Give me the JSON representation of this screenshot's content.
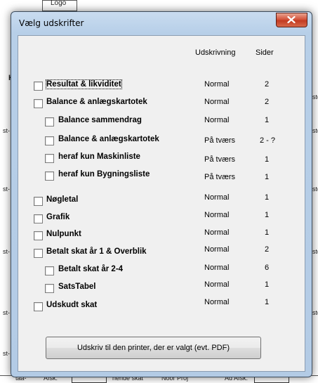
{
  "background": {
    "logo_label": "Logo",
    "left_fragments": [
      "Kl",
      "st-",
      "st-",
      "st-",
      "st-",
      "st-"
    ],
    "right_fragments": [
      "ste",
      "ste",
      "ste",
      "ste",
      "ste"
    ],
    "bottom_fragments": [
      "tåå-",
      "Afsk.",
      "hende skat",
      "Noor Proj",
      "Ad Afsk."
    ]
  },
  "dialog": {
    "title": "Vælg udskrifter",
    "close_icon": "close-icon",
    "columns": {
      "mode": "Udskrivning",
      "pages": "Sider"
    },
    "items": [
      {
        "label": "Resultat & likviditet",
        "mode": "Normal",
        "pages": "2",
        "checked": false
      },
      {
        "label": "Balance & anlægskartotek",
        "mode": "Normal",
        "pages": "2",
        "checked": false
      },
      {
        "label": "Balance sammendrag",
        "mode": "Normal",
        "pages": "1",
        "checked": false
      },
      {
        "label": "Balance & anlægskartotek",
        "mode": "På tværs",
        "pages": "2 - ?",
        "checked": false
      },
      {
        "label": "heraf kun Maskinliste",
        "mode": "På tværs",
        "pages": "1",
        "checked": false
      },
      {
        "label": "heraf kun Bygningsliste",
        "mode": "På tværs",
        "pages": "1",
        "checked": false
      },
      {
        "label": "Nøgletal",
        "mode": "Normal",
        "pages": "1",
        "checked": false
      },
      {
        "label": "Grafik",
        "mode": "Normal",
        "pages": "1",
        "checked": false
      },
      {
        "label": "Nulpunkt",
        "mode": "Normal",
        "pages": "1",
        "checked": false
      },
      {
        "label": "Betalt skat år 1 & Overblik",
        "mode": "Normal",
        "pages": "2",
        "checked": false
      },
      {
        "label": "Betalt skat år 2-4",
        "mode": "Normal",
        "pages": "6",
        "checked": false
      },
      {
        "label": "SatsTabel",
        "mode": "Normal",
        "pages": "1",
        "checked": false
      },
      {
        "label": "Udskudt skat",
        "mode": "Normal",
        "pages": "1",
        "checked": false
      }
    ],
    "print_button": "Udskriv til den printer, der er valgt (evt. PDF)"
  }
}
